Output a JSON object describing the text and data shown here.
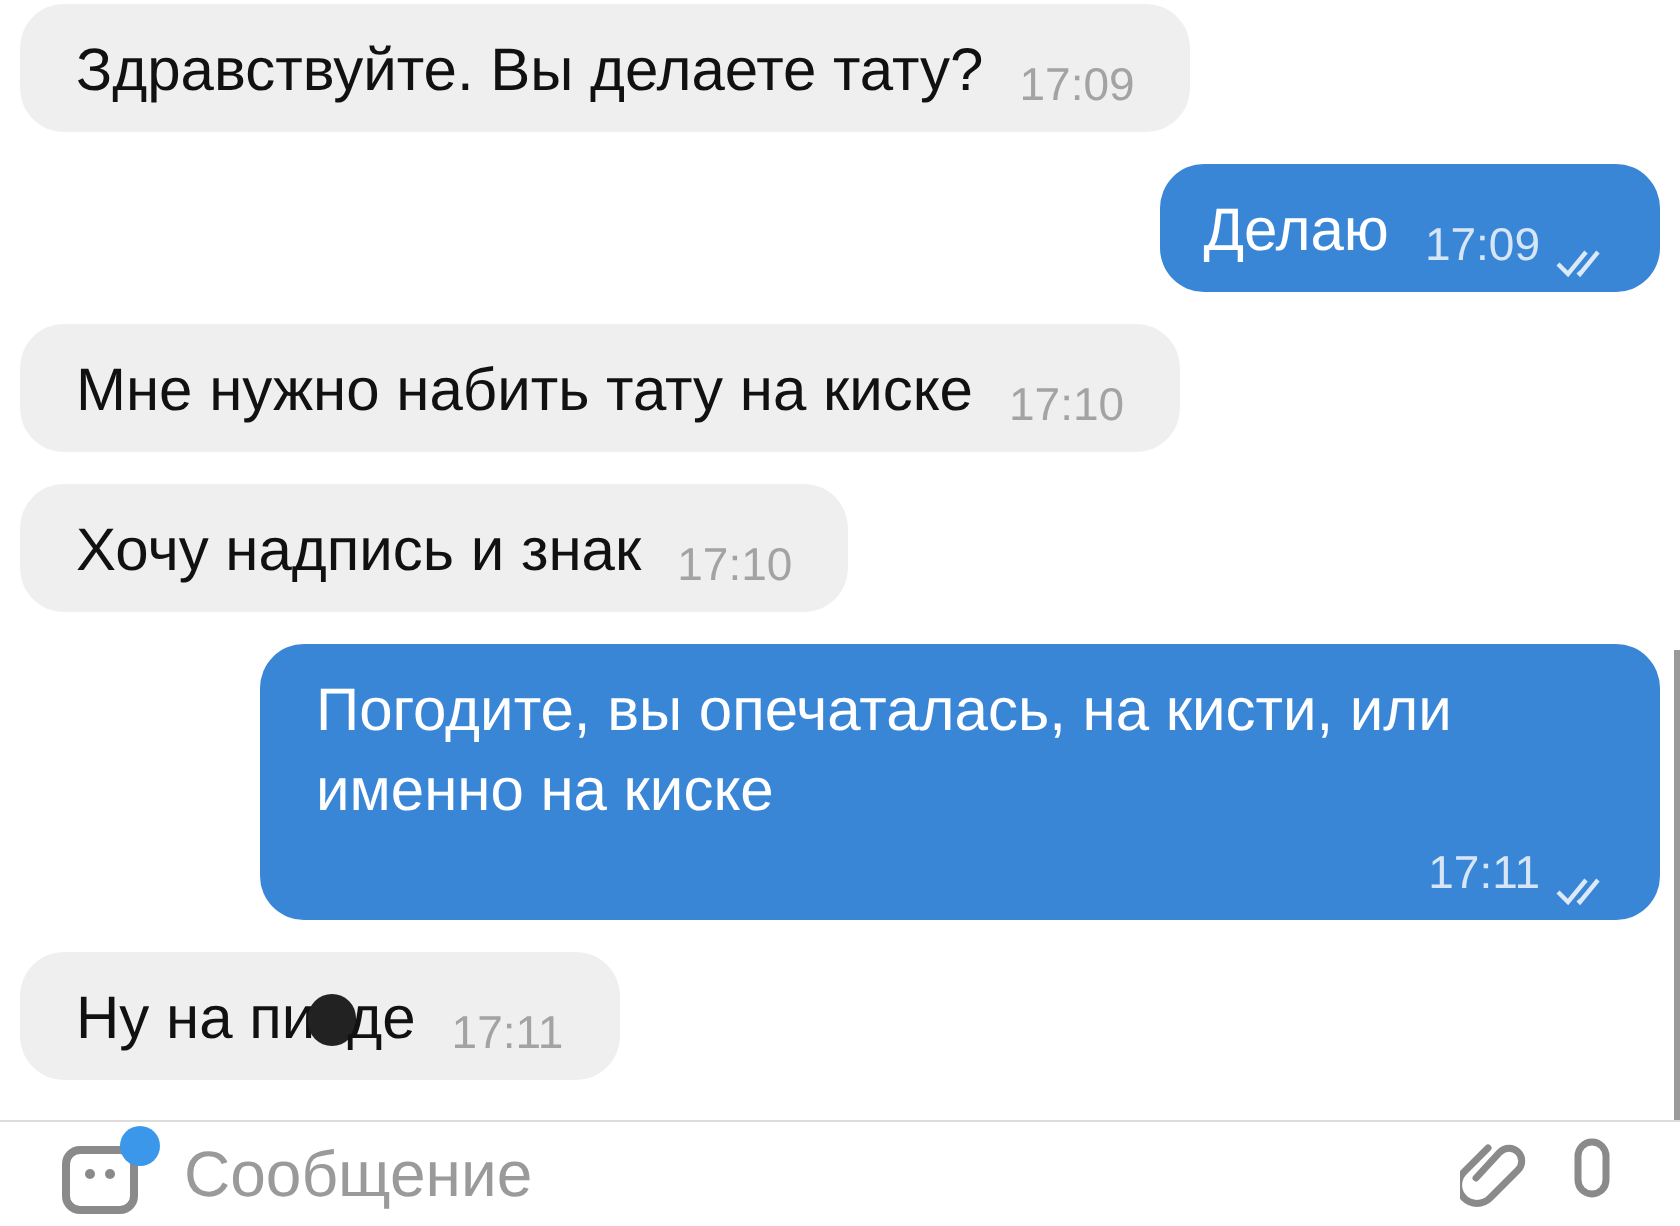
{
  "messages": [
    {
      "kind": "text",
      "outgoing": false,
      "text": "Здравствуйте. Вы делаете тату?",
      "time": "17:09"
    },
    {
      "kind": "text",
      "outgoing": true,
      "text": "Делаю",
      "time": "17:09",
      "read": true
    },
    {
      "kind": "text",
      "outgoing": false,
      "text": "Мне нужно набить тату на киске",
      "time": "17:10"
    },
    {
      "kind": "text",
      "outgoing": false,
      "text": "Хочу надпись и знак",
      "time": "17:10"
    },
    {
      "kind": "text",
      "outgoing": true,
      "text": "Погодите, вы опечаталась, на кисти, или именно на киске",
      "time": "17:11",
      "read": true
    },
    {
      "kind": "censored",
      "outgoing": false,
      "text_before": "Ну на пи",
      "text_after": "де",
      "time": "17:11"
    }
  ],
  "composer": {
    "placeholder": "Сообщение",
    "unread_dot": true
  }
}
